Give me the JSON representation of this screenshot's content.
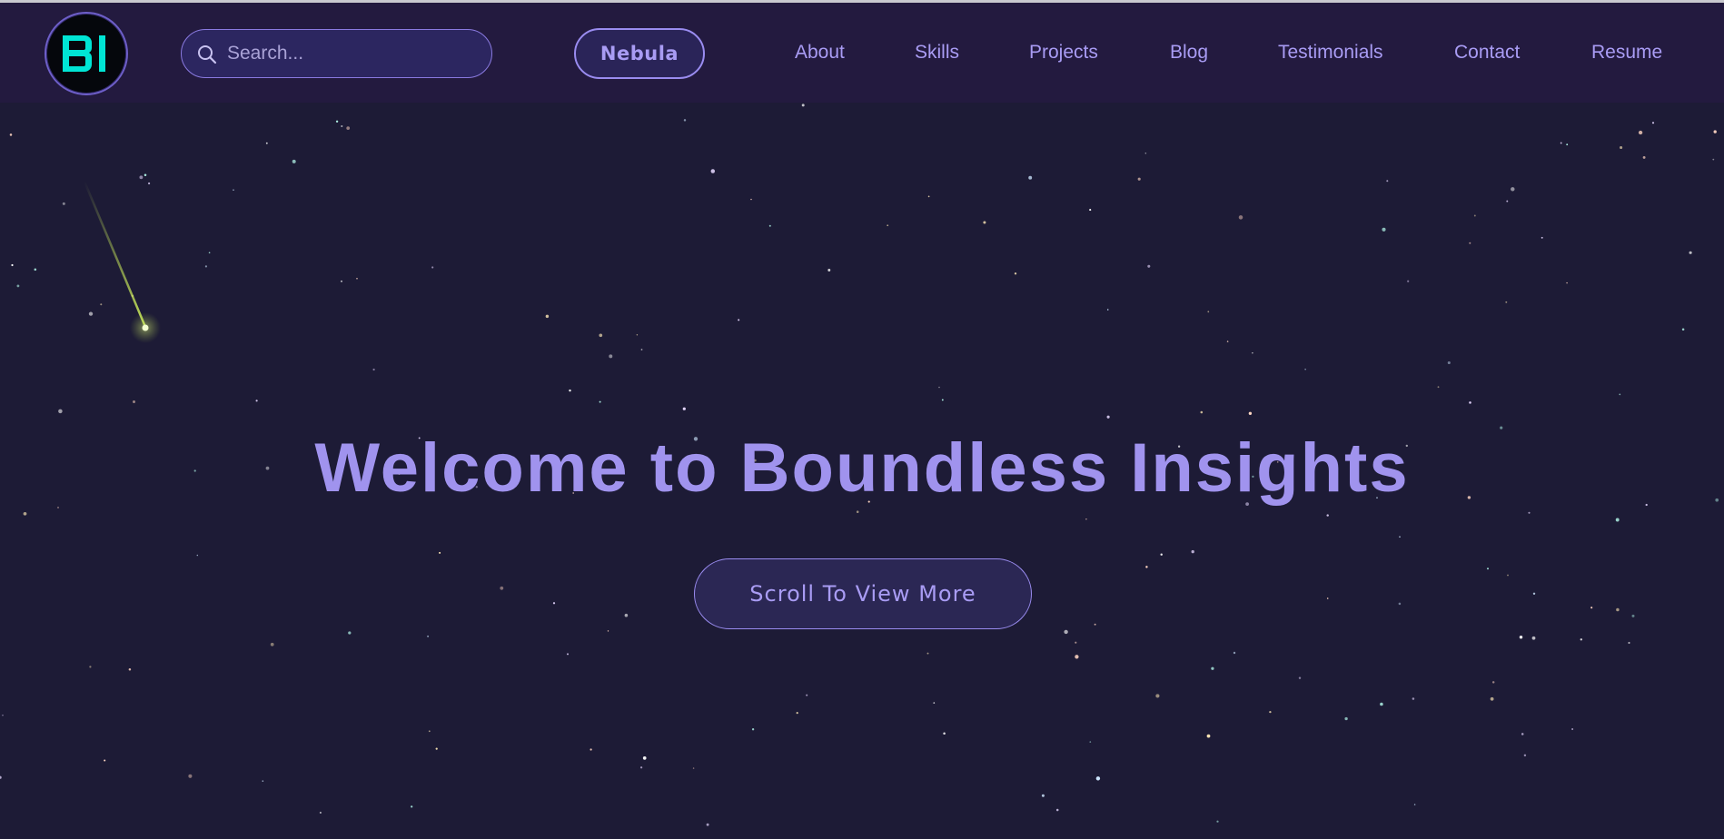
{
  "brand": {
    "logo_text": "BI",
    "logo_color": "#00e5d4"
  },
  "search": {
    "placeholder": "Search...",
    "value": ""
  },
  "theme_button": {
    "label": "Nebula"
  },
  "nav": {
    "items": [
      {
        "label": "About"
      },
      {
        "label": "Skills"
      },
      {
        "label": "Projects"
      },
      {
        "label": "Blog"
      },
      {
        "label": "Testimonials"
      },
      {
        "label": "Contact"
      },
      {
        "label": "Resume"
      }
    ]
  },
  "hero": {
    "title": "Welcome to Boundless Insights",
    "cta_label": "Scroll To View More"
  },
  "colors": {
    "background": "#1d1b36",
    "header": "#231a3f",
    "accent": "#a99cf4",
    "shooting_star": "#c8e85a"
  }
}
